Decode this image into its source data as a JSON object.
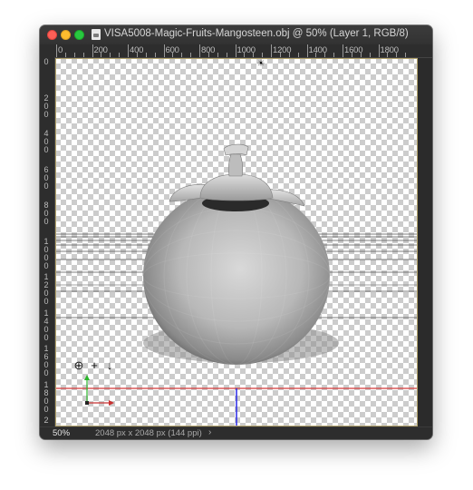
{
  "window": {
    "title": "VISA5008-Magic-Fruits-Mangosteen.obj @ 50% (Layer 1, RGB/8)",
    "doc_icon": "document-icon"
  },
  "ruler": {
    "horizontal_labels": [
      "0",
      "200",
      "400",
      "600",
      "800",
      "1000",
      "1200",
      "1400",
      "1600",
      "1800"
    ],
    "vertical_labels": [
      "0",
      "200",
      "400",
      "600",
      "800",
      "1000",
      "1200",
      "1400",
      "1600",
      "1800",
      "2"
    ]
  },
  "status": {
    "zoom": "50%",
    "doc_size": "2048 px x 2048 px (144 ppi)",
    "chevron": "›"
  },
  "icons": {
    "light": "☀",
    "orbit": "⊕",
    "pan": "+",
    "slide": "↓"
  },
  "colors": {
    "ground_line": "#d43a3a",
    "vertical_axis": "#1a1ae6",
    "y_axis": "#2bb52b",
    "x_axis": "#c83232"
  }
}
